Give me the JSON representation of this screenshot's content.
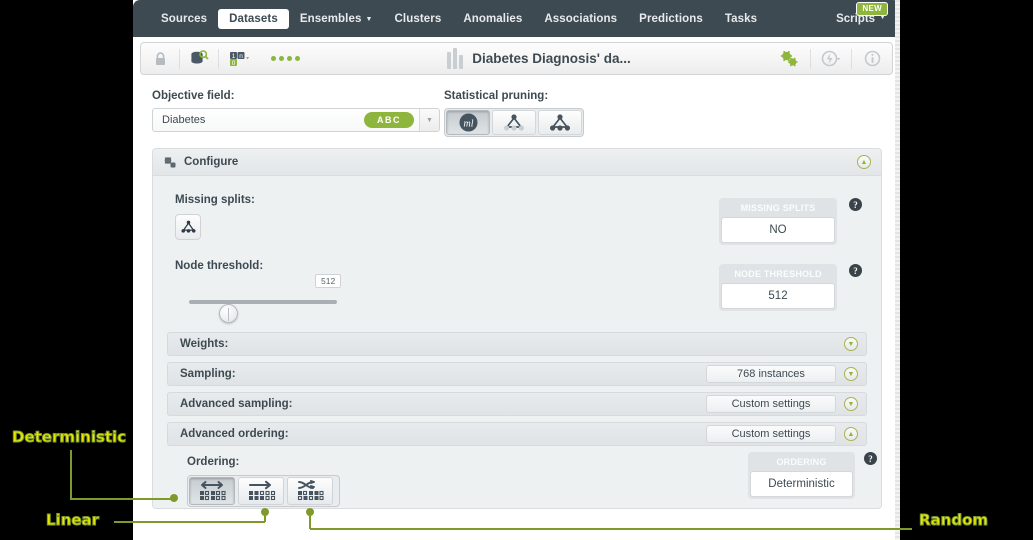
{
  "nav": {
    "items": [
      {
        "label": "Sources",
        "active": false,
        "caret": false
      },
      {
        "label": "Datasets",
        "active": true,
        "caret": false
      },
      {
        "label": "Ensembles",
        "active": false,
        "caret": true
      },
      {
        "label": "Clusters",
        "active": false,
        "caret": false
      },
      {
        "label": "Anomalies",
        "active": false,
        "caret": false
      },
      {
        "label": "Associations",
        "active": false,
        "caret": false
      },
      {
        "label": "Predictions",
        "active": false,
        "caret": false
      },
      {
        "label": "Tasks",
        "active": false,
        "caret": false
      }
    ],
    "scripts_label": "Scripts",
    "new_badge": "NEW"
  },
  "titlebar": {
    "title": "Diabetes Diagnosis' da...",
    "lock_icon": "lock-icon",
    "dataset_search_icon": "dataset-search-icon",
    "field_types_icon": "field-types-icon",
    "gears_icon": "gears-icon",
    "flash_icon": "flash-icon",
    "info_icon": "info-icon"
  },
  "objective": {
    "label": "Objective field:",
    "value": "Diabetes",
    "badge": "ABC"
  },
  "pruning": {
    "label": "Statistical pruning:",
    "options": [
      {
        "name": "ml-default",
        "active": true
      },
      {
        "name": "pruning-off-tree",
        "active": false
      },
      {
        "name": "pruning-on-tree",
        "active": false
      }
    ]
  },
  "configure": {
    "title": "Configure",
    "missing_splits": {
      "label": "Missing splits:",
      "box_title": "MISSING SPLITS",
      "box_value": "NO"
    },
    "node_threshold": {
      "label": "Node threshold:",
      "slider_tooltip": "512",
      "box_title": "NODE THRESHOLD",
      "box_value": "512"
    },
    "rows": [
      {
        "label": "Weights:",
        "pill": null
      },
      {
        "label": "Sampling:",
        "pill": "768 instances"
      },
      {
        "label": "Advanced sampling:",
        "pill": "Custom settings"
      },
      {
        "label": "Advanced ordering:",
        "pill": "Custom settings"
      }
    ],
    "ordering": {
      "label": "Ordering:",
      "options": [
        {
          "name": "ordering-deterministic",
          "active": true
        },
        {
          "name": "ordering-linear",
          "active": false
        },
        {
          "name": "ordering-random",
          "active": false
        }
      ],
      "box_title": "ORDERING",
      "box_value": "Deterministic"
    }
  },
  "annotations": {
    "deterministic": "Deterministic",
    "linear": "Linear",
    "random": "Random",
    "line_color": "#7f9a2b",
    "text_color": "#e9e900"
  }
}
